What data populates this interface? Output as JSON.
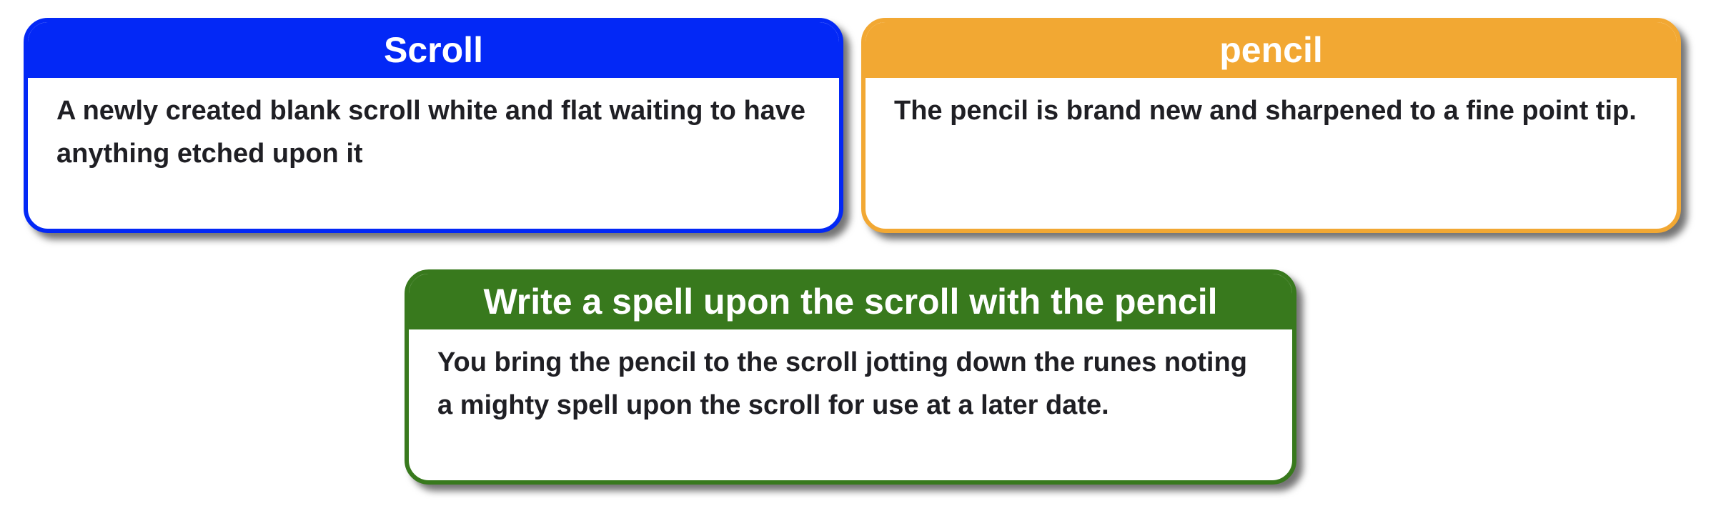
{
  "cards": [
    {
      "id": "scroll",
      "title": "Scroll",
      "body": "A newly created blank scroll white and flat waiting to have anything etched upon it",
      "color": "#0328f6"
    },
    {
      "id": "pencil",
      "title": "pencil",
      "body": "The pencil is brand new and sharpened to a fine point tip.",
      "color": "#f2a833"
    },
    {
      "id": "spell",
      "title": "Write a spell upon the scroll with the pencil",
      "body": "You bring the pencil to the scroll jotting down the runes noting a mighty spell upon the scroll for use at a later date.",
      "color": "#38791d"
    }
  ]
}
